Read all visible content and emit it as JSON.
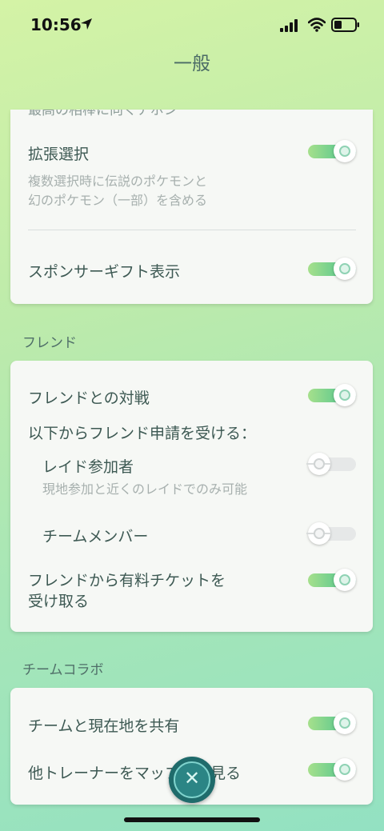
{
  "status_bar": {
    "time": "10:56"
  },
  "header": {
    "title": "一般"
  },
  "card1": {
    "cut_text": "最高の相棒に向くアポン",
    "items": [
      {
        "label": "拡張選択",
        "desc_line1": "複数選択時に伝説のポケモンと",
        "desc_line2": "幻のポケモン（一部）を含める",
        "on": true
      },
      {
        "label": "スポンサーギフト表示",
        "on": true
      }
    ]
  },
  "section_friend": {
    "title": "フレンド"
  },
  "card2": {
    "items": [
      {
        "label": "フレンドとの対戦",
        "on": true
      },
      {
        "label": "以下からフレンド申請を受ける："
      },
      {
        "label": "レイド参加者",
        "desc": "現地参加と近くのレイドでのみ可能",
        "on": false
      },
      {
        "label": "チームメンバー",
        "on": false
      },
      {
        "label_line1": "フレンドから有料チケットを",
        "label_line2": "受け取る",
        "on": true
      }
    ]
  },
  "section_team": {
    "title": "チームコラボ"
  },
  "card3": {
    "items": [
      {
        "label": "チームと現在地を共有",
        "on": true
      },
      {
        "label": "他トレーナーをマップ上で見る",
        "on": true
      }
    ]
  },
  "fab": {
    "icon": "close-icon",
    "glyph": "✕"
  },
  "colors": {
    "accent": "#3fbf8f",
    "fab": "#1f6b6b"
  }
}
